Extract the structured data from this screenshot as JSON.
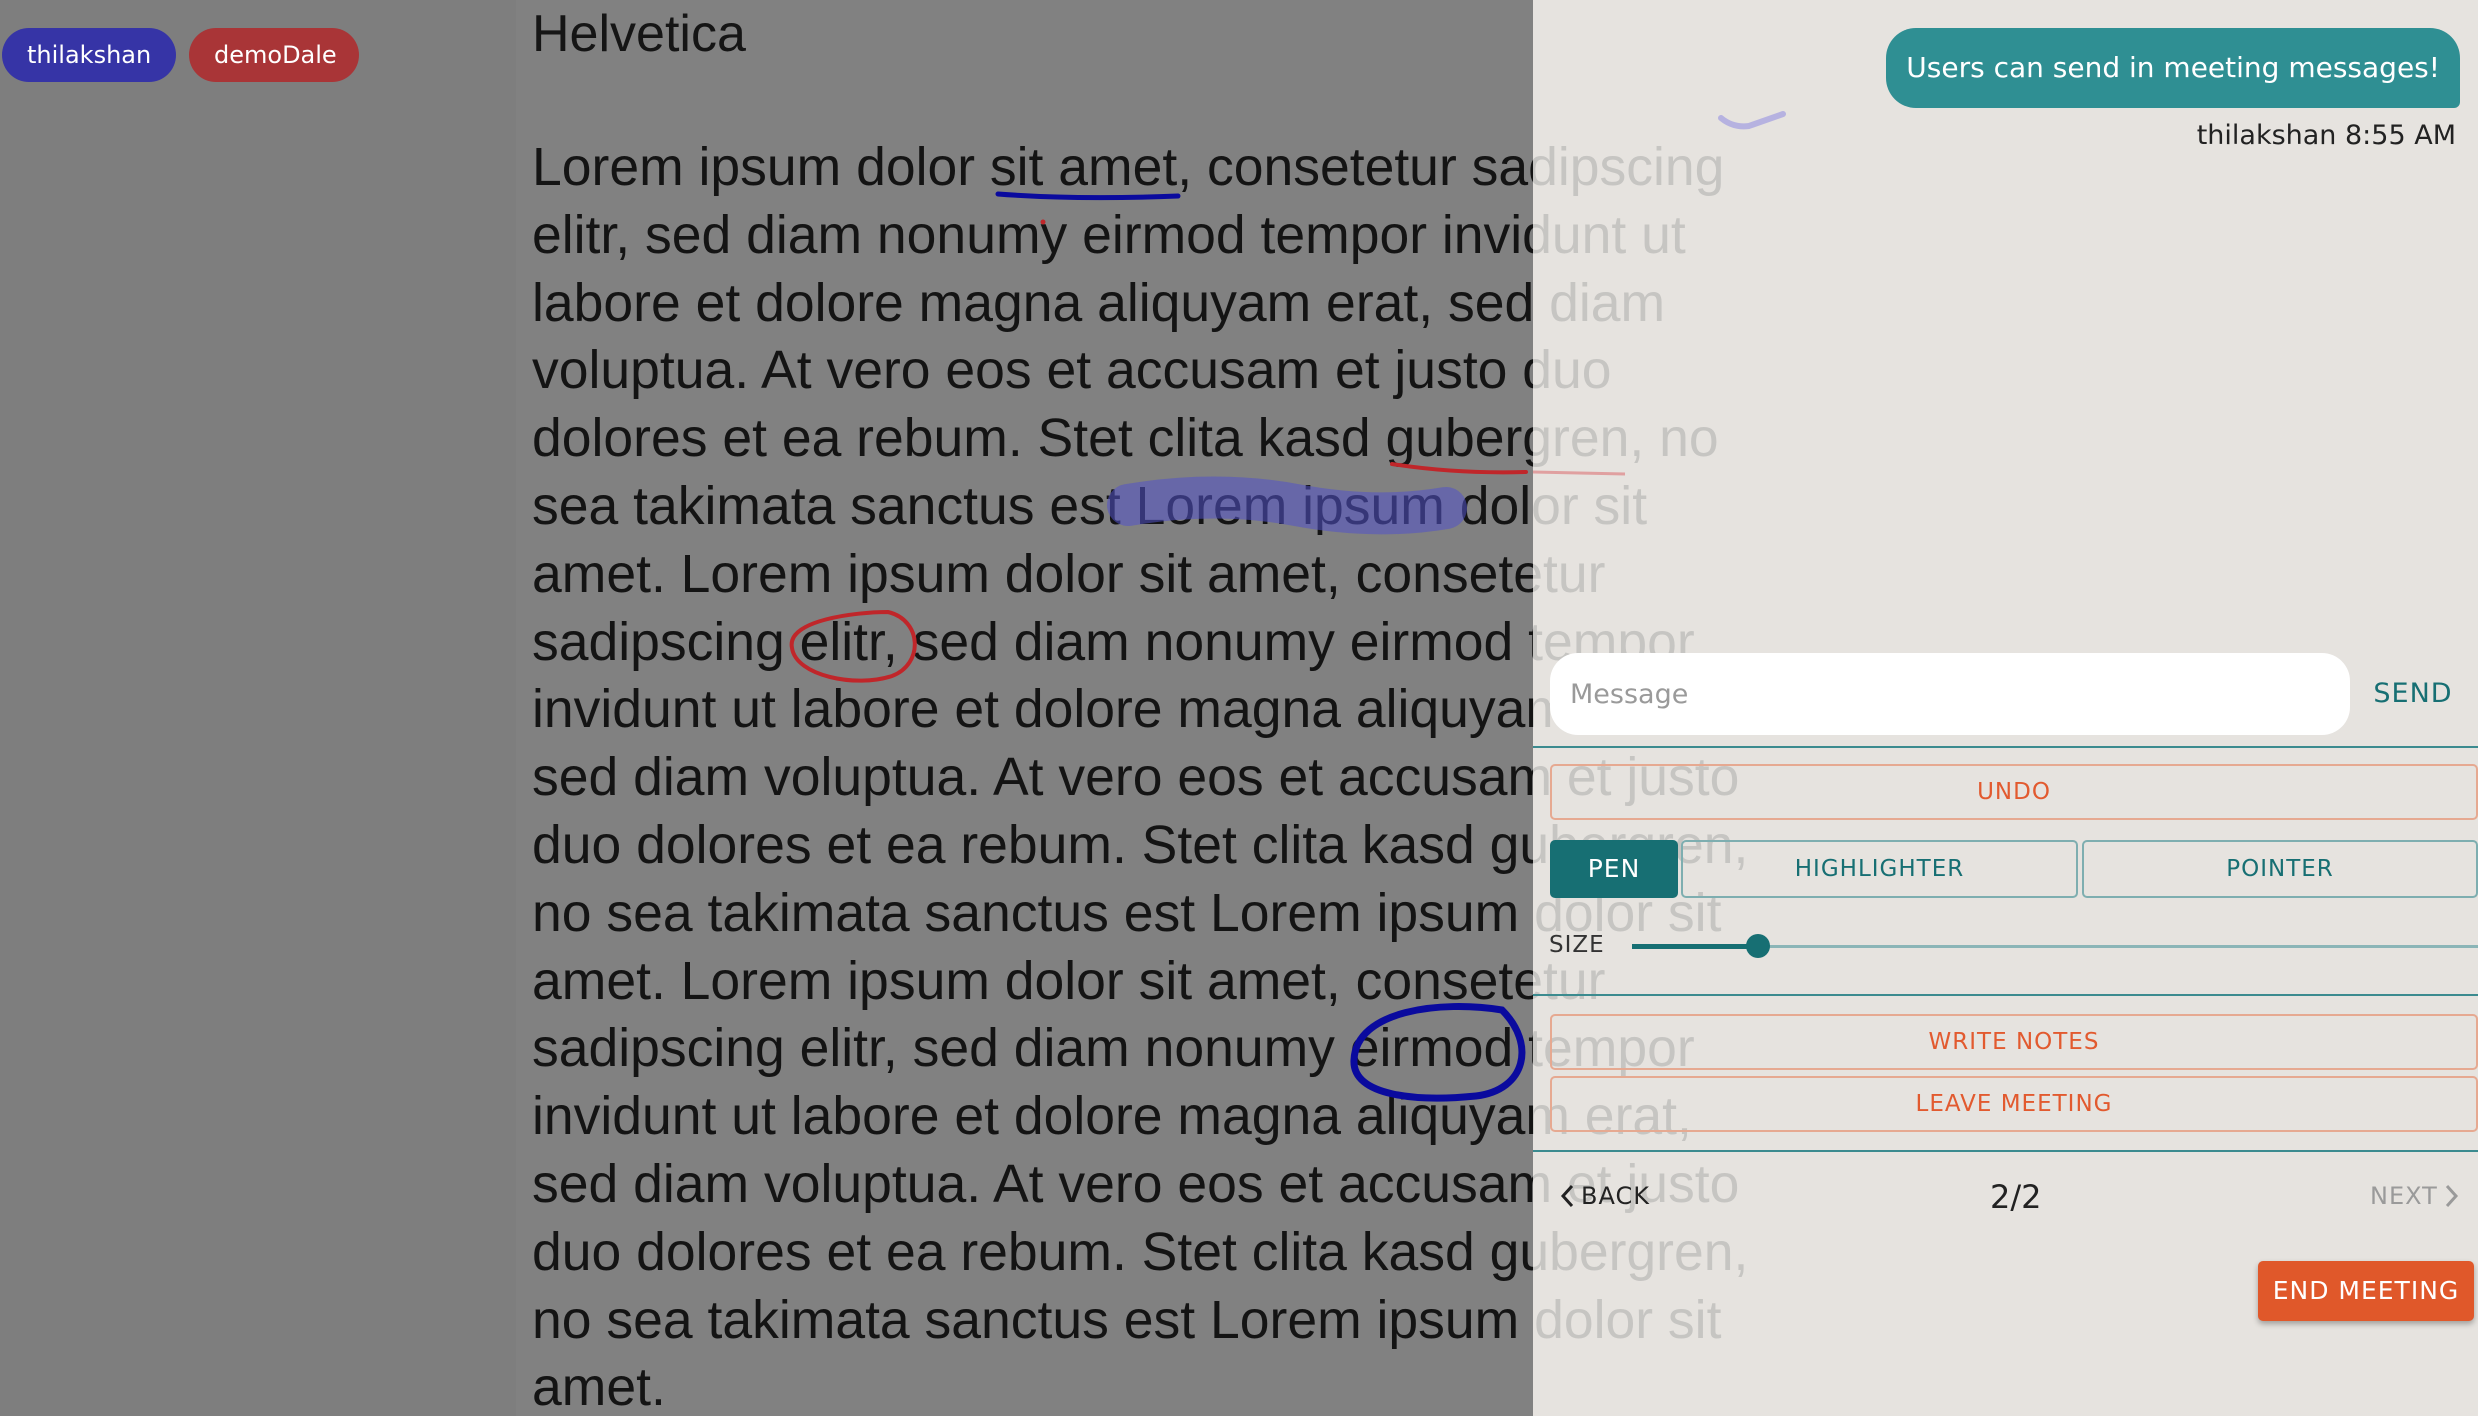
{
  "participants": [
    {
      "name": "thilakshan",
      "color": "#3634a6"
    },
    {
      "name": "demoDale",
      "color": "#a93537"
    }
  ],
  "document": {
    "title": "Helvetica",
    "lines": [
      "Lorem ipsum dolor sit amet, consetetur sadipscing",
      "elitr, sed diam nonumy eirmod tempor invidunt ut",
      "labore et dolore magna aliquyam erat, sed diam",
      "voluptua. At vero eos et accusam et justo duo",
      "dolores et ea rebum. Stet clita kasd gubergren, no",
      "sea takimata sanctus est Lorem ipsum dolor sit",
      "amet. Lorem ipsum dolor sit amet, consetetur",
      "sadipscing elitr, sed diam nonumy eirmod tempor",
      "invidunt ut labore et dolore magna aliquyam erat,",
      "sed diam voluptua. At vero eos et accusam et justo",
      "duo dolores et ea rebum. Stet clita kasd gubergren,",
      "no sea takimata sanctus est Lorem ipsum dolor sit",
      "amet. Lorem ipsum dolor sit amet, consetetur",
      "sadipscing elitr, sed diam nonumy eirmod tempor",
      "invidunt ut labore et dolore magna aliquyam erat,",
      "sed diam voluptua. At vero eos et accusam et justo",
      "duo dolores et ea rebum. Stet clita kasd gubergren,",
      "no sea takimata sanctus est Lorem ipsum dolor sit",
      "amet."
    ]
  },
  "chat": {
    "message_text": "Users can send in meeting messages!",
    "message_meta": "thilakshan 8:55 AM",
    "input_placeholder": "Message",
    "send_label": "SEND"
  },
  "controls": {
    "undo_label": "UNDO",
    "tools": [
      {
        "label": "PEN",
        "active": true
      },
      {
        "label": "HIGHLIGHTER",
        "active": false
      },
      {
        "label": "POINTER",
        "active": false
      }
    ],
    "size_label": "SIZE",
    "size_level": 0.14,
    "write_notes_label": "WRITE NOTES",
    "leave_meeting_label": "LEAVE MEETING"
  },
  "pagination": {
    "back_label": "BACK",
    "page_indicator": "2/2",
    "next_label": "NEXT"
  },
  "end_meeting_label": "END MEETING",
  "colors": {
    "accent_teal": "#176f73",
    "bubble_teal": "#2f8f93",
    "danger_orange": "#e0582a",
    "ink_blue": "#0a0a9e",
    "ink_red": "#c0262a"
  }
}
